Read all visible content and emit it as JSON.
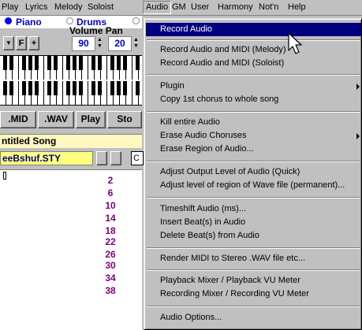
{
  "menubar": {
    "items": [
      {
        "label": "Play"
      },
      {
        "label": "Lyrics"
      },
      {
        "label": "Melody"
      },
      {
        "label": "Soloist"
      },
      {
        "label": "Audio",
        "active": true
      },
      {
        "label": "GM"
      },
      {
        "label": "User"
      },
      {
        "label": "Harmony"
      },
      {
        "label": "Not'n"
      },
      {
        "label": "Help"
      }
    ]
  },
  "background": {
    "radio_piano": "Piano",
    "radio_drums": "Drums",
    "volume_pan_label": "Volume Pan",
    "btn_f": "F",
    "btn_plus": "+",
    "volume_value": "90",
    "pan_value": "20",
    "file_buttons": [
      ".MID",
      ".WAV",
      "Play",
      "Sto"
    ],
    "song_title": "ntitled Song",
    "style_name": "eeBshuf.STY",
    "key_box": "C",
    "bar_numbers": [
      "2",
      "6",
      "10",
      "14",
      "18",
      "22",
      "26",
      "30",
      "34",
      "38"
    ]
  },
  "audio_menu": {
    "items": [
      {
        "label": "Record Audio",
        "highlighted": true
      },
      {
        "label": "Record Audio and MIDI (Melody)"
      },
      {
        "label": "Record Audio and MIDI (Soloist)"
      },
      {
        "label": "Plugin",
        "submenu": true
      },
      {
        "label": "Copy 1st chorus to whole song"
      },
      {
        "label": "Kill entire Audio"
      },
      {
        "label": "Erase Audio Choruses",
        "submenu": true
      },
      {
        "label": "Erase Region of Audio..."
      },
      {
        "label": "Adjust Output Level of Audio (Quick)"
      },
      {
        "label": "Adjust level of region of Wave file (permanent)..."
      },
      {
        "label": "Timeshift Audio (ms)..."
      },
      {
        "label": "Insert Beat(s) in Audio"
      },
      {
        "label": "Delete Beat(s) from Audio"
      },
      {
        "label": "Render MIDI to Stereo .WAV file etc..."
      },
      {
        "label": "Playback Mixer / Playback VU Meter"
      },
      {
        "label": "Recording Mixer / Recording VU Meter"
      },
      {
        "label": "Audio Options..."
      }
    ]
  },
  "colors": {
    "menu_highlight": "#000080",
    "face": "#c0c0c0"
  },
  "icons": {
    "cursor": "arrow-cursor-icon",
    "submenu": "submenu-arrow-icon"
  }
}
